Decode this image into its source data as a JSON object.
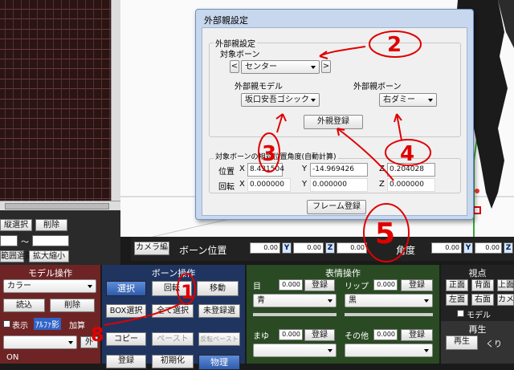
{
  "timeline": {
    "rows": 20,
    "select_vertical": "縦選択",
    "delete": "削除",
    "tilde": "～",
    "range_select": "範囲選択",
    "expand_shrink": "拡大縮小"
  },
  "dialog": {
    "title": "外部親設定",
    "group_title": "外部親設定",
    "target_bone_label": "対象ボーン",
    "prev": "<",
    "next": ">",
    "target_bone_value": "センター",
    "parent_model_label": "外部親モデル",
    "parent_model_value": "坂口安吾ゴシック",
    "parent_bone_label": "外部親ボーン",
    "parent_bone_value": "右ダミー",
    "register_button": "外親登録",
    "relative_title": "対象ボーンの相対位置角度(自動計算)",
    "position_label": "位置",
    "rotation_label": "回転",
    "pos_x": "8.431504",
    "pos_y": "-14.969426",
    "pos_z": "0.204028",
    "rot_x": "0.000000",
    "rot_y": "0.000000",
    "rot_z": "0.000000",
    "axis_x": "X",
    "axis_y": "Y",
    "axis_z": "Z",
    "frame_register": "フレーム登録"
  },
  "bonebar": {
    "camera_tab": "カメラ編",
    "bone_position": "ボーン位置",
    "angle": "角度",
    "values": [
      "0.00",
      "0.00",
      "0.00",
      "0.00",
      "0.00"
    ],
    "x": "X",
    "y": "Y",
    "z": "Z"
  },
  "model_panel": {
    "title": "モデル操作",
    "dropdown": "カラー",
    "load": "読込",
    "delete": "削除",
    "display": "表示",
    "alpha": "ｱﾙﾌｧ影",
    "add": "加算",
    "outer_short": "外",
    "on": "ON"
  },
  "bone_panel": {
    "title": "ボーン操作",
    "select": "選択",
    "rotate": "回転",
    "move": "移動",
    "box_select": "BOX選択",
    "select_all": "全て選択",
    "unregistered": "未登録選",
    "copy": "コピー",
    "paste": "ペースト",
    "reverse_paste": "反転ペースト",
    "register": "登録",
    "init": "初期化",
    "physics": "物理"
  },
  "face_panel": {
    "title": "表情操作",
    "eye": "目",
    "lip": "リップ",
    "eyebrow": "まゆ",
    "other": "その他",
    "eye_value": "0.000",
    "lip_value": "0.000",
    "eyebrow_value": "0.000",
    "other_value": "0.000",
    "register": "登録",
    "eye_select": "青",
    "lip_select": "黒"
  },
  "view_panel": {
    "title": "視点",
    "front": "正面",
    "back": "背面",
    "top": "上面",
    "left": "左面",
    "right": "右面",
    "camera": "カメ",
    "model": "モデル",
    "playback_title": "再生",
    "play": "再生",
    "repeat": "くり"
  },
  "annotations": {
    "n1": "1",
    "n2": "2",
    "n3": "3",
    "n4": "4",
    "n5": "5",
    "n8": "8",
    "color": "#e00000"
  }
}
